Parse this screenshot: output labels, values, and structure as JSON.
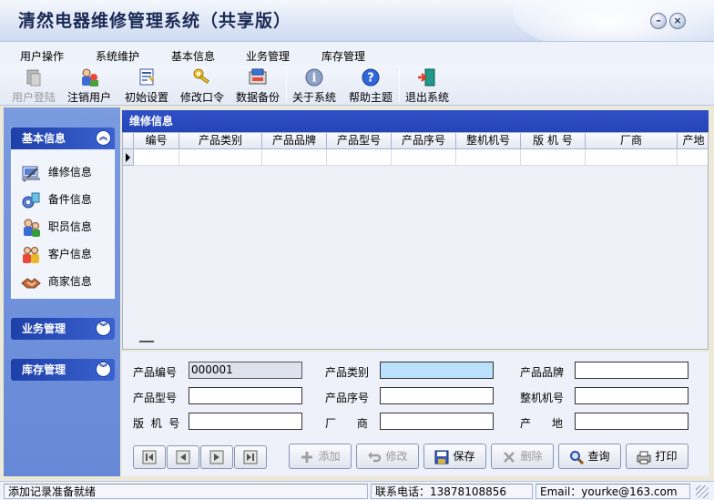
{
  "window": {
    "title": "清然电器维修管理系统（共享版）",
    "minimize_symbol": "–",
    "close_symbol": "×"
  },
  "menu": [
    "用户操作",
    "系统维护",
    "基本信息",
    "业务管理",
    "库存管理"
  ],
  "toolbar": [
    {
      "label": "用户登陆",
      "icon": "user-login-icon",
      "enabled": false
    },
    {
      "label": "注销用户",
      "icon": "logout-user-icon",
      "enabled": true
    },
    {
      "label": "初始设置",
      "icon": "init-settings-icon",
      "enabled": true
    },
    {
      "label": "修改口令",
      "icon": "key-icon",
      "enabled": true
    },
    {
      "label": "数据备份",
      "icon": "backup-icon",
      "enabled": true
    },
    {
      "label": "关于系统",
      "icon": "info-icon",
      "enabled": true
    },
    {
      "label": "帮助主题",
      "icon": "help-icon",
      "enabled": true
    },
    {
      "label": "退出系统",
      "icon": "exit-door-icon",
      "enabled": true
    }
  ],
  "sidebar": {
    "sections": [
      {
        "title": "基本信息",
        "expanded": true
      },
      {
        "title": "业务管理",
        "expanded": false
      },
      {
        "title": "库存管理",
        "expanded": false
      }
    ],
    "items": [
      {
        "label": "维修信息",
        "icon": "repair-icon"
      },
      {
        "label": "备件信息",
        "icon": "parts-icon"
      },
      {
        "label": "职员信息",
        "icon": "staff-icon"
      },
      {
        "label": "客户信息",
        "icon": "customer-icon"
      },
      {
        "label": "商家信息",
        "icon": "merchant-icon"
      }
    ]
  },
  "main": {
    "title": "维修信息",
    "columns": [
      "编号",
      "产品类别",
      "产品品牌",
      "产品型号",
      "产品序号",
      "整机机号",
      "版 机 号",
      "厂商",
      "产地"
    ]
  },
  "form": {
    "fields": [
      {
        "label": "产品编号",
        "value": "000001"
      },
      {
        "label": "产品类别",
        "value": ""
      },
      {
        "label": "产品品牌",
        "value": ""
      },
      {
        "label": "产品型号",
        "value": ""
      },
      {
        "label": "产品序号",
        "value": ""
      },
      {
        "label": "整机机号",
        "value": ""
      },
      {
        "label": "版  机  号",
        "value": ""
      },
      {
        "label": "厂      商",
        "value": ""
      },
      {
        "label": "产      地",
        "value": ""
      }
    ],
    "actions": [
      {
        "label": "添加",
        "enabled": false
      },
      {
        "label": "修改",
        "enabled": false
      },
      {
        "label": "保存",
        "enabled": true
      },
      {
        "label": "删除",
        "enabled": false
      },
      {
        "label": "查询",
        "enabled": true
      },
      {
        "label": "打印",
        "enabled": true
      }
    ]
  },
  "status": {
    "message": "添加记录准备就绪",
    "phone_label": "联系电话：",
    "phone": "13878108856",
    "email_label": "Email：",
    "email": "yourke@163.com"
  },
  "colors": {
    "accent": "#2445b7",
    "sidebar": "#6688d6",
    "highlight_input": "#b9e1fb"
  }
}
